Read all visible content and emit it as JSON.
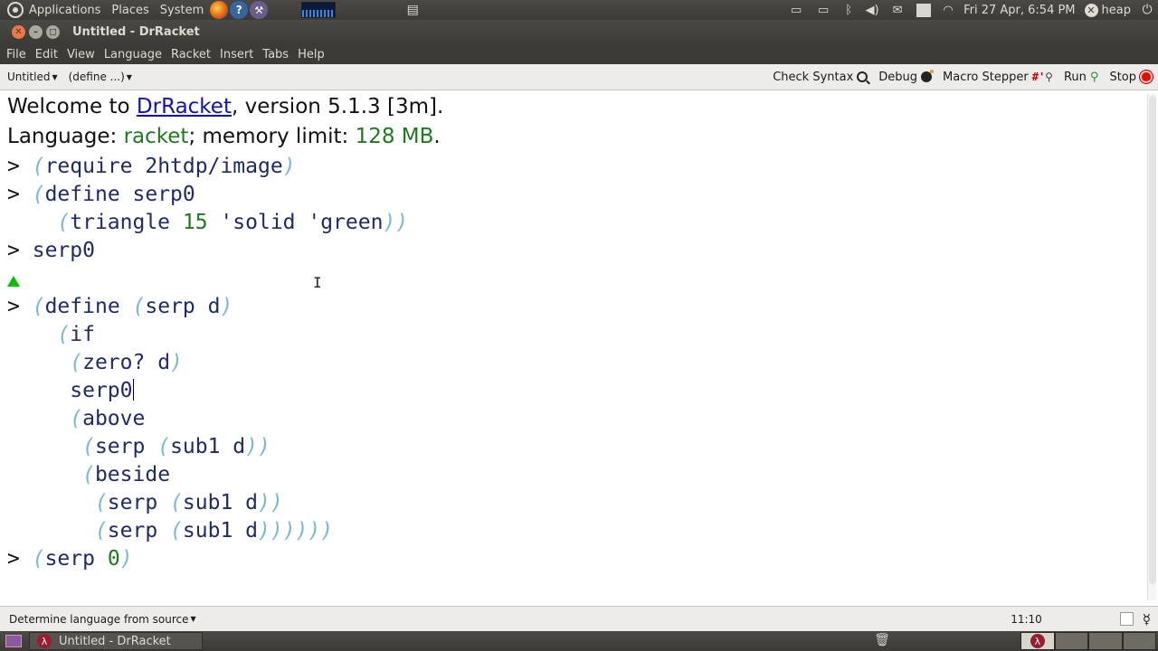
{
  "panel": {
    "menus": [
      "Applications",
      "Places",
      "System"
    ],
    "clock": "Fri 27 Apr,  6:54 PM",
    "user": "heap"
  },
  "window": {
    "title": "Untitled - DrRacket"
  },
  "menubar": [
    "File",
    "Edit",
    "View",
    "Language",
    "Racket",
    "Insert",
    "Tabs",
    "Help"
  ],
  "toolbar": {
    "file_dropdown": "Untitled",
    "define_dropdown": "(define ...)",
    "check_syntax": "Check Syntax",
    "debug": "Debug",
    "macro_stepper": "Macro Stepper",
    "macro_glyph": "#'",
    "run": "Run",
    "stop": "Stop"
  },
  "repl": {
    "welcome_prefix": "Welcome to ",
    "welcome_link": "DrRacket",
    "welcome_suffix": ", version 5.1.3 [3m].",
    "lang_prefix": "Language: ",
    "lang_name": "racket",
    "lang_mid": "; memory limit: ",
    "lang_limit": "128 MB",
    "lang_end": ".",
    "prompt": ">",
    "require_kw": "require 2htdp/image",
    "define1": "define serp0",
    "triangle_head": "triangle ",
    "triangle_num": "15",
    "triangle_tail": " 'solid 'green",
    "serp0": "serp0",
    "define2_head": "define ",
    "define2_sig": "serp d",
    "if_kw": "if",
    "zero_test": "zero? d",
    "serp0_base": "serp0",
    "above_kw": "above",
    "serp_sub1_a": "serp ",
    "sub1_d": "sub1 d",
    "beside_kw": "beside",
    "call_head": "serp ",
    "call_num": "0"
  },
  "status": {
    "language_selector": "Determine language from source",
    "cursor_position": "11:10"
  },
  "taskbar": {
    "item_label": "Untitled - DrRacket"
  }
}
